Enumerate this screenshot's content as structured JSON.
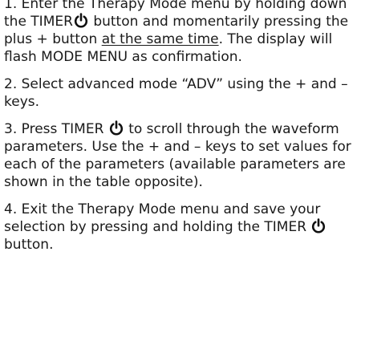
{
  "steps": [
    {
      "a": "1. Enter the Therapy Mode menu by holding down the TIMER",
      "b": " button and momentarily pressing the plus + button ",
      "underlined": "at the same time",
      "c": ". The display will flash MODE MENU as confirmation."
    },
    {
      "a": "2. Select advanced mode “ADV” using the + and – keys."
    },
    {
      "a": "3. Press TIMER",
      "b": " to scroll through the waveform parameters. Use the + and – keys to set values for each of the parameters (available parameters are shown in the table opposite)."
    },
    {
      "a": "4. Exit the Therapy Mode menu and save your selection by pressing and holding the TIMER",
      "b": " button."
    }
  ],
  "icons": {
    "timer": "power-icon"
  }
}
